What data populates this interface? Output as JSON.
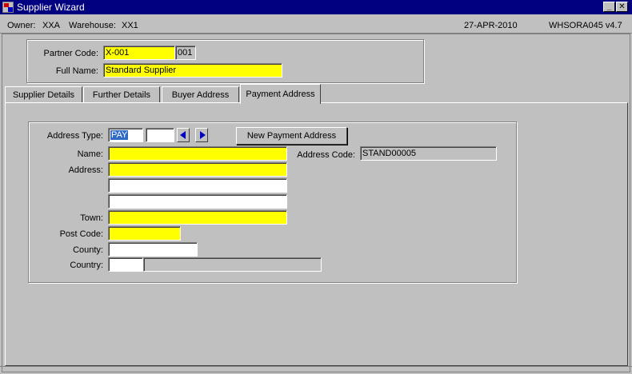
{
  "window": {
    "title": "Supplier Wizard",
    "minimize_label": "_",
    "close_label": "✕"
  },
  "info": {
    "owner_label": "Owner:",
    "owner_value": "XXA",
    "warehouse_label": "Warehouse:",
    "warehouse_value": "XX1",
    "date": "27-APR-2010",
    "version": "WHSORA045  v4.7"
  },
  "partner": {
    "code_label": "Partner Code:",
    "code_value": "X-001",
    "code_suffix": "001",
    "fullname_label": "Full Name:",
    "fullname_value": "Standard Supplier"
  },
  "tabs": [
    {
      "label": "Supplier Details",
      "active": false
    },
    {
      "label": "Further Details",
      "active": false
    },
    {
      "label": "Buyer Address",
      "active": false
    },
    {
      "label": "Payment Address",
      "active": true
    }
  ],
  "payment": {
    "address_type_label": "Address Type:",
    "address_type_value": "PAY",
    "address_type_extra": "",
    "new_button_label": "New Payment Address",
    "name_label": "Name:",
    "name_value": "",
    "address_label": "Address:",
    "address_lines": [
      "",
      "",
      ""
    ],
    "town_label": "Town:",
    "town_value": "",
    "postcode_label": "Post Code:",
    "postcode_value": "",
    "county_label": "County:",
    "county_value": "",
    "country_label": "Country:",
    "country_code": "",
    "country_name": "",
    "address_code_label": "Address Code:",
    "address_code_value": "STAND00005"
  },
  "colors": {
    "required": "#ffff00",
    "titlebar": "#000080",
    "window": "#c0c0c0"
  }
}
